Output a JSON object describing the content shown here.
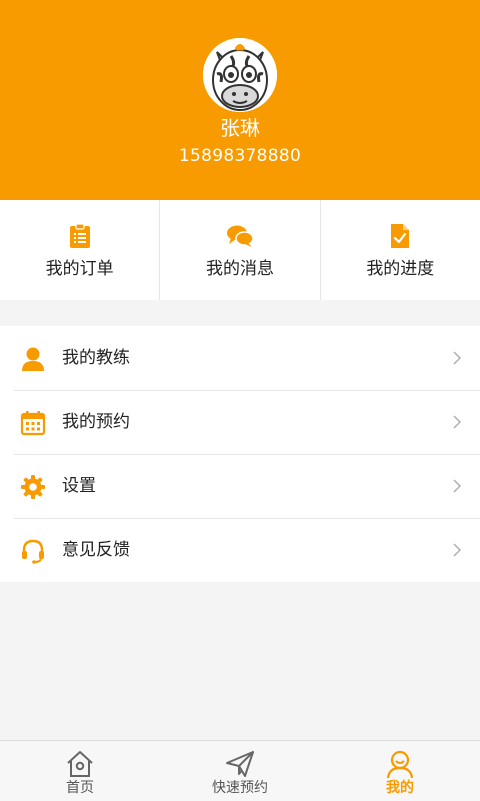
{
  "profile": {
    "name": "张琳",
    "phone": "15898378880"
  },
  "quick_links": [
    {
      "label": "我的订单",
      "icon": "clipboard-icon"
    },
    {
      "label": "我的消息",
      "icon": "chat-bubbles-icon"
    },
    {
      "label": "我的进度",
      "icon": "progress-document-icon"
    }
  ],
  "menu": [
    {
      "label": "我的教练",
      "icon": "person-icon"
    },
    {
      "label": "我的预约",
      "icon": "calendar-icon"
    },
    {
      "label": "设置",
      "icon": "gear-icon"
    },
    {
      "label": "意见反馈",
      "icon": "headset-icon"
    }
  ],
  "tabs": [
    {
      "label": "首页",
      "icon": "home-icon",
      "active": false
    },
    {
      "label": "快速预约",
      "icon": "paper-plane-icon",
      "active": false
    },
    {
      "label": "我的",
      "icon": "user-smile-icon",
      "active": true
    }
  ],
  "colors": {
    "accent": "#f89b00",
    "background": "#f4f4f4"
  }
}
